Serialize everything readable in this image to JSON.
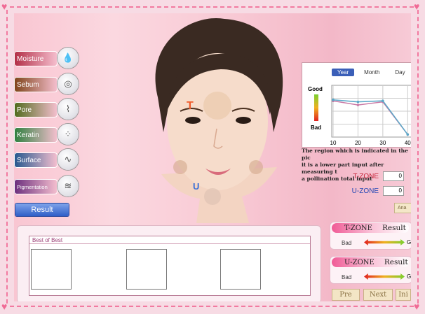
{
  "menu": {
    "items": [
      {
        "label": "Moisture",
        "color": "#b22d45",
        "icon": "water-drop-icon"
      },
      {
        "label": "Sebum",
        "color": "#7e4318",
        "icon": "oil-drop-icon"
      },
      {
        "label": "Pore",
        "color": "#4f6a1b",
        "icon": "pore-hair-icon"
      },
      {
        "label": "Keratin",
        "color": "#2d7f3e",
        "icon": "keratin-cells-icon"
      },
      {
        "label": "Surface",
        "color": "#24578e",
        "icon": "surface-wave-icon"
      },
      {
        "label": "Pigmentation",
        "color": "#6a2d7c",
        "icon": "pigmentation-lines-icon"
      }
    ],
    "result_label": "Result"
  },
  "face": {
    "t_marker": "T",
    "u_marker": "U"
  },
  "chart": {
    "tabs": [
      "Year",
      "Month",
      "Day"
    ],
    "active_tab": "Year",
    "good_label": "Good",
    "bad_label": "Bad",
    "x_ticks": [
      "10",
      "20",
      "30",
      "40"
    ],
    "chart_data": {
      "type": "line",
      "x": [
        10,
        20,
        30,
        40
      ],
      "series": [
        {
          "values": [
            0.7,
            0.62,
            0.68,
            0.05
          ],
          "color": "#c97aa6"
        },
        {
          "values": [
            0.72,
            0.68,
            0.7,
            0.05
          ],
          "color": "#5aa8c8"
        }
      ],
      "grid": true
    }
  },
  "info": {
    "line1": "The region which is indicated in the pic",
    "line2": "it is a lower part input after measuring t",
    "line3": "a pollination total input"
  },
  "zones": {
    "t_label": "T-ZONE",
    "t_value": "0",
    "u_label": "U-ZONE",
    "u_value": "0",
    "analysis_label": "Ana"
  },
  "best": {
    "title": "Best of Best"
  },
  "results": {
    "t_zone": "T-ZONE",
    "u_zone": "U-ZONE",
    "result_word": "Result",
    "bad": "Bad",
    "good_cut": "G"
  },
  "nav": {
    "prev": "Pre",
    "next": "Next",
    "init": "Ini"
  }
}
